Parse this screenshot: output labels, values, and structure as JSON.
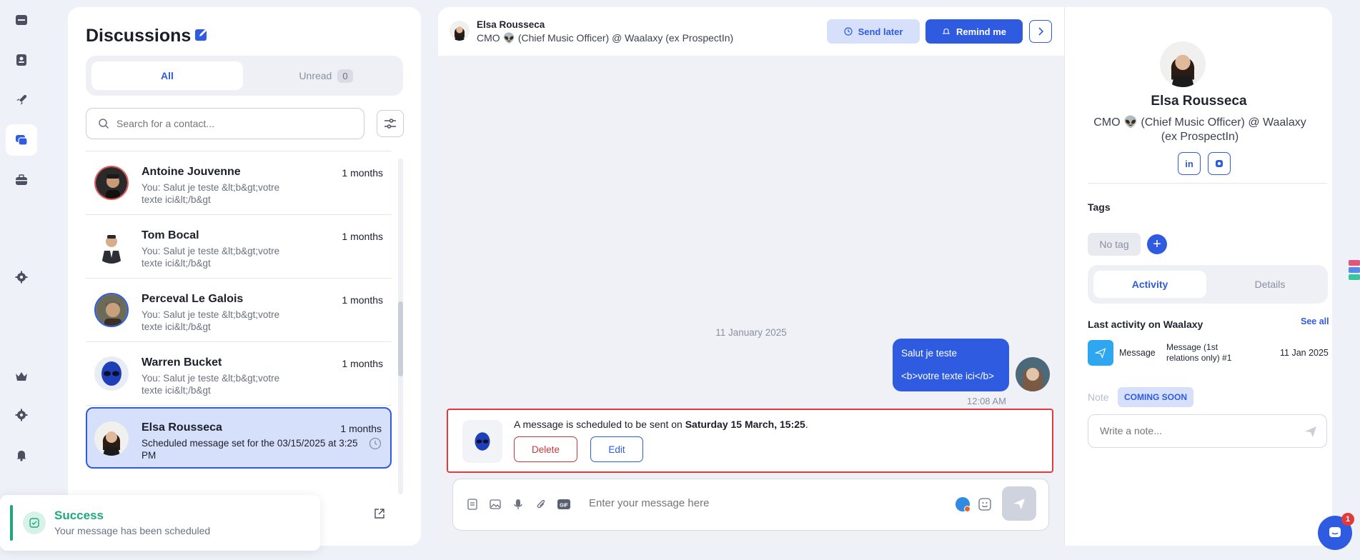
{
  "discussions": {
    "title": "Discussions",
    "tabs": {
      "all": "All",
      "unread": "Unread",
      "unread_count": "0"
    },
    "search_placeholder": "Search for a contact...",
    "items": [
      {
        "name": "Antoine Jouvenne",
        "time": "1 months",
        "preview": "You: Salut je teste &lt;b&gt;votre texte ici&lt;/b&gt"
      },
      {
        "name": "Tom Bocal",
        "time": "1 months",
        "preview": "You: Salut je teste &lt;b&gt;votre texte ici&lt;/b&gt"
      },
      {
        "name": "Perceval Le Galois",
        "time": "1 months",
        "preview": "You: Salut je teste &lt;b&gt;votre texte ici&lt;/b&gt"
      },
      {
        "name": "Warren Bucket",
        "time": "1 months",
        "preview": "You: Salut je teste &lt;b&gt;votre texte ici&lt;/b&gt"
      },
      {
        "name": "Elsa Rousseca",
        "time": "1 months",
        "preview": "Scheduled message set for the 03/15/2025 at 3:25 PM"
      }
    ]
  },
  "toast": {
    "title": "Success",
    "message": "Your message has been scheduled"
  },
  "chat": {
    "name": "Elsa Rousseca",
    "subtitle": "CMO 👽 (Chief Music Officer) @ Waalaxy (ex ProspectIn)",
    "send_later": "Send later",
    "remind_me": "Remind me",
    "date_separator": "11 January 2025",
    "message": {
      "line1": "Salut je teste",
      "line2": "<b>votre texte ici</b>",
      "time": "12:08 AM"
    },
    "scheduled": {
      "text_prefix": "A message is scheduled to be sent on ",
      "text_date": "Saturday 15 March, 15:25",
      "text_suffix": ".",
      "delete": "Delete",
      "edit": "Edit"
    },
    "composer_placeholder": "Enter your message here"
  },
  "profile": {
    "name": "Elsa Rousseca",
    "title": "CMO 👽 (Chief Music Officer) @ Waalaxy (ex ProspectIn)",
    "linkedin": "in",
    "tags_heading": "Tags",
    "no_tag": "No tag",
    "tabs": {
      "activity": "Activity",
      "details": "Details"
    },
    "last_activity": "Last activity on Waalaxy",
    "see_all": "See all",
    "activity": {
      "type": "Message",
      "desc": "Message (1st relations only) #1",
      "date": "11 Jan 2025"
    },
    "note_label": "Note",
    "coming_soon": "COMING SOON",
    "note_placeholder": "Write a note..."
  },
  "support": {
    "unread": "1"
  },
  "colors": {
    "accent": "#2f5be0",
    "success": "#1ea97c",
    "danger": "#e03a3a"
  }
}
